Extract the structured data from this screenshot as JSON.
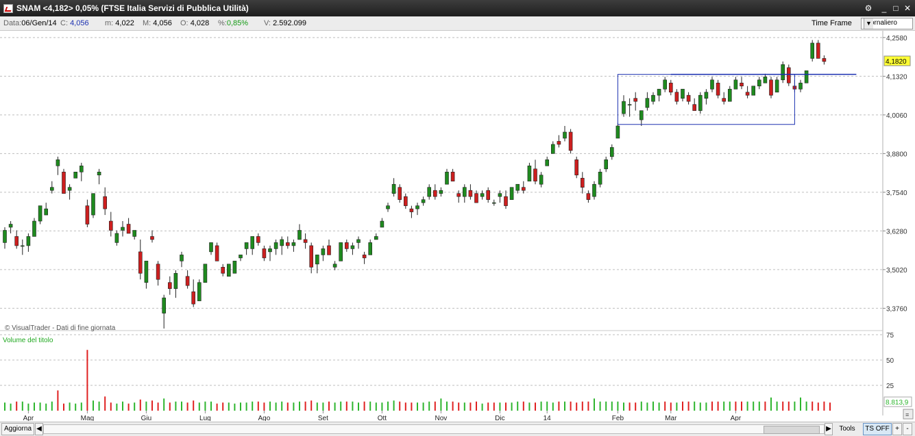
{
  "window": {
    "title": "SNAM <4,182> 0,05%  (FTSE Italia Servizi di Pubblica Utilità)",
    "controls": [
      "⚙",
      "_",
      "□",
      "✕"
    ]
  },
  "infobar": {
    "date_label": "Data:",
    "date_value": "06/Gen/14",
    "close_label": "C:",
    "close_value": "4,056",
    "min_label": "m:",
    "min_value": "4,022",
    "max_label": "M:",
    "max_value": "4,056",
    "open_label": "O:",
    "open_value": "4,028",
    "pct_label": "%:",
    "pct_value": "0,85%",
    "vol_label": "V:",
    "vol_value": "2.592.099",
    "time_frame_label": "Time Frame",
    "time_frame_value": "Giornaliero"
  },
  "bottombar": {
    "refresh_label": "Aggiorna",
    "tools_label": "Tools",
    "ts_label": "TS OFF",
    "zoom_in": "+",
    "zoom_out": "-"
  },
  "colors": {
    "up": "#1f8a1f",
    "down": "#cc1f1f",
    "annotation": "#1a2fb0",
    "price_tag_bg": "#ffff33",
    "volume_up": "#2db52d",
    "volume_down": "#e02020"
  },
  "chart_data": [
    {
      "type": "candlestick",
      "name": "price",
      "credit": "© VisualTrader - Dati di fine giornata",
      "ylim": [
        3.31,
        4.28
      ],
      "y_ticks": [
        4.258,
        4.132,
        4.006,
        3.88,
        3.754,
        3.628,
        3.502,
        3.376
      ],
      "y_tick_labels": [
        "4,2580",
        "4,1320",
        "4,0060",
        "3,8800",
        "3,7540",
        "3,6280",
        "3,5020",
        "3,3760"
      ],
      "last_price": 4.182,
      "last_price_label": "4,1820",
      "grid": true,
      "points": [
        [
          3.59,
          3.64,
          3.57,
          3.63
        ],
        [
          3.64,
          3.66,
          3.62,
          3.65
        ],
        [
          3.61,
          3.63,
          3.57,
          3.58
        ],
        [
          3.58,
          3.6,
          3.55,
          3.58
        ],
        [
          3.58,
          3.62,
          3.56,
          3.61
        ],
        [
          3.61,
          3.67,
          3.61,
          3.66
        ],
        [
          3.66,
          3.71,
          3.65,
          3.71
        ],
        [
          3.68,
          3.72,
          3.68,
          3.7
        ],
        [
          3.76,
          3.79,
          3.75,
          3.77
        ],
        [
          3.84,
          3.87,
          3.81,
          3.86
        ],
        [
          3.82,
          3.83,
          3.75,
          3.75
        ],
        [
          3.76,
          3.78,
          3.73,
          3.77
        ],
        [
          3.8,
          3.82,
          3.8,
          3.82
        ],
        [
          3.82,
          3.85,
          3.79,
          3.84
        ],
        [
          3.71,
          3.73,
          3.64,
          3.65
        ],
        [
          3.68,
          3.75,
          3.67,
          3.75
        ],
        [
          3.81,
          3.83,
          3.78,
          3.82
        ],
        [
          3.74,
          3.77,
          3.68,
          3.7
        ],
        [
          3.66,
          3.69,
          3.61,
          3.63
        ],
        [
          3.59,
          3.63,
          3.58,
          3.62
        ],
        [
          3.63,
          3.66,
          3.61,
          3.64
        ],
        [
          3.65,
          3.67,
          3.62,
          3.62
        ],
        [
          3.61,
          3.63,
          3.6,
          3.63
        ],
        [
          3.56,
          3.6,
          3.47,
          3.49
        ],
        [
          3.46,
          3.53,
          3.44,
          3.53
        ],
        [
          3.61,
          3.63,
          3.59,
          3.6
        ],
        [
          3.52,
          3.53,
          3.45,
          3.47
        ],
        [
          3.36,
          3.42,
          3.31,
          3.41
        ],
        [
          3.46,
          3.48,
          3.42,
          3.44
        ],
        [
          3.44,
          3.5,
          3.41,
          3.49
        ],
        [
          3.53,
          3.56,
          3.51,
          3.55
        ],
        [
          3.48,
          3.5,
          3.44,
          3.45
        ],
        [
          3.43,
          3.47,
          3.38,
          3.39
        ],
        [
          3.4,
          3.47,
          3.4,
          3.46
        ],
        [
          3.46,
          3.52,
          3.46,
          3.52
        ],
        [
          3.56,
          3.59,
          3.55,
          3.59
        ],
        [
          3.58,
          3.59,
          3.53,
          3.53
        ],
        [
          3.51,
          3.52,
          3.48,
          3.49
        ],
        [
          3.48,
          3.52,
          3.48,
          3.52
        ],
        [
          3.49,
          3.53,
          3.49,
          3.53
        ],
        [
          3.54,
          3.55,
          3.53,
          3.55
        ],
        [
          3.57,
          3.59,
          3.55,
          3.59
        ],
        [
          3.57,
          3.61,
          3.55,
          3.61
        ],
        [
          3.61,
          3.62,
          3.58,
          3.59
        ],
        [
          3.57,
          3.58,
          3.53,
          3.54
        ],
        [
          3.56,
          3.58,
          3.53,
          3.57
        ],
        [
          3.57,
          3.6,
          3.55,
          3.59
        ],
        [
          3.58,
          3.61,
          3.55,
          3.6
        ],
        [
          3.59,
          3.61,
          3.57,
          3.58
        ],
        [
          3.58,
          3.6,
          3.56,
          3.59
        ],
        [
          3.6,
          3.65,
          3.6,
          3.63
        ],
        [
          3.6,
          3.62,
          3.57,
          3.59
        ],
        [
          3.58,
          3.59,
          3.49,
          3.51
        ],
        [
          3.52,
          3.55,
          3.49,
          3.55
        ],
        [
          3.55,
          3.58,
          3.53,
          3.57
        ],
        [
          3.58,
          3.6,
          3.55,
          3.55
        ],
        [
          3.51,
          3.53,
          3.5,
          3.52
        ],
        [
          3.53,
          3.59,
          3.53,
          3.59
        ],
        [
          3.59,
          3.6,
          3.56,
          3.57
        ],
        [
          3.57,
          3.59,
          3.55,
          3.58
        ],
        [
          3.59,
          3.61,
          3.57,
          3.6
        ],
        [
          3.55,
          3.56,
          3.52,
          3.54
        ],
        [
          3.55,
          3.6,
          3.55,
          3.59
        ],
        [
          3.6,
          3.62,
          3.6,
          3.61
        ],
        [
          3.64,
          3.67,
          3.64,
          3.66
        ],
        [
          3.7,
          3.72,
          3.69,
          3.71
        ],
        [
          3.75,
          3.8,
          3.74,
          3.78
        ],
        [
          3.77,
          3.78,
          3.72,
          3.73
        ],
        [
          3.74,
          3.75,
          3.7,
          3.71
        ],
        [
          3.7,
          3.71,
          3.67,
          3.69
        ],
        [
          3.7,
          3.72,
          3.68,
          3.71
        ],
        [
          3.72,
          3.74,
          3.71,
          3.73
        ],
        [
          3.74,
          3.78,
          3.73,
          3.77
        ],
        [
          3.76,
          3.78,
          3.73,
          3.74
        ],
        [
          3.75,
          3.77,
          3.74,
          3.76
        ],
        [
          3.78,
          3.83,
          3.78,
          3.82
        ],
        [
          3.82,
          3.83,
          3.79,
          3.79
        ],
        [
          3.75,
          3.76,
          3.72,
          3.74
        ],
        [
          3.74,
          3.78,
          3.72,
          3.77
        ],
        [
          3.76,
          3.78,
          3.73,
          3.74
        ],
        [
          3.75,
          3.76,
          3.72,
          3.72
        ],
        [
          3.74,
          3.76,
          3.73,
          3.75
        ],
        [
          3.76,
          3.77,
          3.72,
          3.73
        ],
        [
          3.72,
          3.73,
          3.71,
          3.72
        ],
        [
          3.74,
          3.76,
          3.72,
          3.75
        ],
        [
          3.74,
          3.76,
          3.7,
          3.71
        ],
        [
          3.73,
          3.77,
          3.73,
          3.77
        ],
        [
          3.76,
          3.78,
          3.75,
          3.78
        ],
        [
          3.77,
          3.79,
          3.75,
          3.76
        ],
        [
          3.79,
          3.85,
          3.79,
          3.84
        ],
        [
          3.83,
          3.86,
          3.78,
          3.79
        ],
        [
          3.78,
          3.82,
          3.77,
          3.81
        ],
        [
          3.84,
          3.87,
          3.84,
          3.86
        ],
        [
          3.88,
          3.92,
          3.88,
          3.91
        ],
        [
          3.92,
          3.94,
          3.9,
          3.91
        ],
        [
          3.93,
          3.97,
          3.92,
          3.95
        ],
        [
          3.95,
          3.96,
          3.88,
          3.89
        ],
        [
          3.86,
          3.87,
          3.8,
          3.81
        ],
        [
          3.8,
          3.82,
          3.75,
          3.77
        ],
        [
          3.75,
          3.76,
          3.72,
          3.73
        ],
        [
          3.74,
          3.79,
          3.73,
          3.78
        ],
        [
          3.78,
          3.83,
          3.77,
          3.82
        ],
        [
          3.83,
          3.87,
          3.82,
          3.86
        ],
        [
          3.87,
          3.91,
          3.86,
          3.9
        ],
        [
          3.93,
          3.98,
          3.93,
          3.97
        ],
        [
          4.01,
          4.07,
          4.0,
          4.05
        ],
        [
          4.04,
          4.06,
          4.0,
          4.04
        ],
        [
          4.06,
          4.08,
          4.02,
          4.05
        ],
        [
          3.99,
          4.02,
          3.97,
          4.02
        ],
        [
          4.03,
          4.08,
          4.02,
          4.06
        ],
        [
          4.05,
          4.08,
          4.04,
          4.07
        ],
        [
          4.07,
          4.09,
          4.05,
          4.09
        ],
        [
          4.09,
          4.13,
          4.08,
          4.12
        ],
        [
          4.11,
          4.12,
          4.07,
          4.08
        ],
        [
          4.08,
          4.09,
          4.04,
          4.05
        ],
        [
          4.06,
          4.09,
          4.05,
          4.09
        ],
        [
          4.07,
          4.08,
          4.04,
          4.05
        ],
        [
          4.04,
          4.06,
          4.02,
          4.02
        ],
        [
          4.02,
          4.08,
          4.01,
          4.07
        ],
        [
          4.06,
          4.09,
          4.04,
          4.08
        ],
        [
          4.09,
          4.13,
          4.08,
          4.12
        ],
        [
          4.11,
          4.12,
          4.06,
          4.07
        ],
        [
          4.06,
          4.08,
          4.04,
          4.05
        ],
        [
          4.05,
          4.1,
          4.05,
          4.09
        ],
        [
          4.09,
          4.13,
          4.09,
          4.12
        ],
        [
          4.11,
          4.13,
          4.09,
          4.1
        ],
        [
          4.08,
          4.1,
          4.06,
          4.07
        ],
        [
          4.07,
          4.1,
          4.07,
          4.1
        ],
        [
          4.1,
          4.13,
          4.09,
          4.12
        ],
        [
          4.11,
          4.14,
          4.11,
          4.13
        ],
        [
          4.12,
          4.13,
          4.06,
          4.07
        ],
        [
          4.08,
          4.13,
          4.08,
          4.12
        ],
        [
          4.12,
          4.18,
          4.11,
          4.17
        ],
        [
          4.16,
          4.17,
          4.1,
          4.11
        ],
        [
          4.1,
          4.12,
          4.08,
          4.09
        ],
        [
          4.09,
          4.12,
          4.08,
          4.11
        ],
        [
          4.11,
          4.15,
          4.11,
          4.15
        ],
        [
          4.19,
          4.25,
          4.18,
          4.24
        ],
        [
          4.24,
          4.25,
          4.19,
          4.19
        ],
        [
          4.19,
          4.2,
          4.17,
          4.18
        ]
      ],
      "annotations": [
        {
          "type": "rectangle",
          "x0": 104,
          "x1": 134,
          "y0": 4.138,
          "y1": 3.975
        },
        {
          "type": "hline",
          "x0": 113,
          "x1": 144,
          "y": 4.138
        }
      ]
    },
    {
      "type": "bar",
      "name": "volume",
      "title": "Volume del titolo",
      "ylim": [
        0,
        75
      ],
      "y_ticks": [
        75,
        50,
        25
      ],
      "y_tick_labels": [
        "75",
        "50",
        "25"
      ],
      "last_value_label": "8.813,9",
      "values": [
        8,
        7,
        9,
        9,
        7,
        8,
        8,
        7,
        9,
        20,
        7,
        8,
        7,
        8,
        60,
        10,
        9,
        14,
        8,
        7,
        9,
        7,
        8,
        11,
        9,
        10,
        8,
        12,
        8,
        9,
        9,
        8,
        10,
        8,
        9,
        9,
        7,
        8,
        8,
        7,
        8,
        8,
        9,
        9,
        8,
        9,
        8,
        9,
        8,
        8,
        9,
        9,
        10,
        8,
        8,
        9,
        8,
        9,
        9,
        9,
        8,
        9,
        9,
        8,
        8,
        9,
        10,
        9,
        8,
        8,
        8,
        8,
        9,
        9,
        12,
        9,
        9,
        8,
        8,
        8,
        9,
        7,
        8,
        8,
        8,
        8,
        8,
        9,
        9,
        8,
        8,
        9,
        9,
        8,
        9,
        9,
        9,
        8,
        9,
        9,
        12,
        9,
        9,
        9,
        9,
        8,
        8,
        8,
        9,
        8,
        9,
        8,
        9,
        8,
        8,
        9,
        9,
        9,
        8,
        8,
        9,
        9,
        9,
        9,
        9,
        9,
        9,
        9,
        9,
        9,
        13,
        9,
        9,
        9,
        9,
        13,
        9,
        9,
        8,
        9,
        8
      ],
      "directions": [
        1,
        1,
        0,
        1,
        1,
        1,
        1,
        1,
        1,
        0,
        0,
        1,
        1,
        1,
        0,
        1,
        1,
        0,
        0,
        1,
        1,
        0,
        1,
        0,
        1,
        0,
        0,
        1,
        0,
        1,
        1,
        0,
        0,
        1,
        1,
        1,
        0,
        0,
        1,
        1,
        1,
        1,
        1,
        0,
        0,
        1,
        1,
        1,
        0,
        1,
        1,
        0,
        0,
        1,
        1,
        0,
        1,
        1,
        0,
        1,
        1,
        0,
        1,
        1,
        1,
        1,
        1,
        0,
        0,
        0,
        1,
        1,
        1,
        0,
        1,
        1,
        0,
        0,
        1,
        0,
        0,
        1,
        0,
        0,
        1,
        0,
        1,
        1,
        0,
        1,
        0,
        1,
        1,
        1,
        0,
        1,
        0,
        0,
        0,
        0,
        1,
        1,
        1,
        1,
        1,
        1,
        0,
        0,
        1,
        1,
        1,
        1,
        0,
        0,
        1,
        0,
        0,
        1,
        1,
        1,
        0,
        0,
        1,
        1,
        0,
        0,
        1,
        1,
        1,
        0,
        1,
        1,
        0,
        0,
        1,
        1,
        1,
        0,
        0,
        0,
        0
      ]
    }
  ],
  "x_axis": {
    "labels": [
      "Apr",
      "Mag",
      "Giu",
      "Lug",
      "Ago",
      "Set",
      "Ott",
      "Nov",
      "Dic",
      "14",
      "Feb",
      "Mar",
      "Apr"
    ],
    "label_bar_index": [
      4,
      14,
      24,
      34,
      44,
      54,
      64,
      74,
      84,
      92,
      104,
      113,
      124
    ]
  }
}
